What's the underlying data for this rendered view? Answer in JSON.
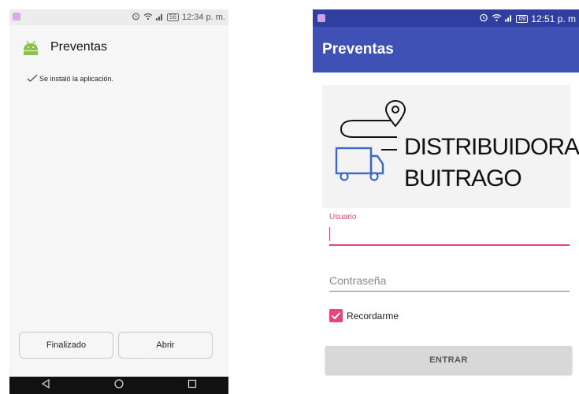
{
  "left_screen": {
    "status_bar": {
      "time": "12:34 p. m.",
      "battery": "56"
    },
    "installer": {
      "app_name": "Preventas",
      "message": "Se instaló la aplicación."
    },
    "buttons": {
      "done": "Finalizado",
      "open": "Abrir"
    }
  },
  "right_screen": {
    "status_bar": {
      "time": "12:51 p. m",
      "battery": "69"
    },
    "app_bar": {
      "title": "Preventas",
      "color": "#3f51b5"
    },
    "logo": {
      "line1": "DISTRIBUIDORA",
      "line2": "BUITRAGO"
    },
    "form": {
      "username_label": "Usuario",
      "username_value": "",
      "password_placeholder": "Contraseña",
      "remember_label": "Recordarme",
      "remember_checked": true,
      "submit_label": "ENTRAR"
    },
    "accent_color": "#e4457c"
  }
}
